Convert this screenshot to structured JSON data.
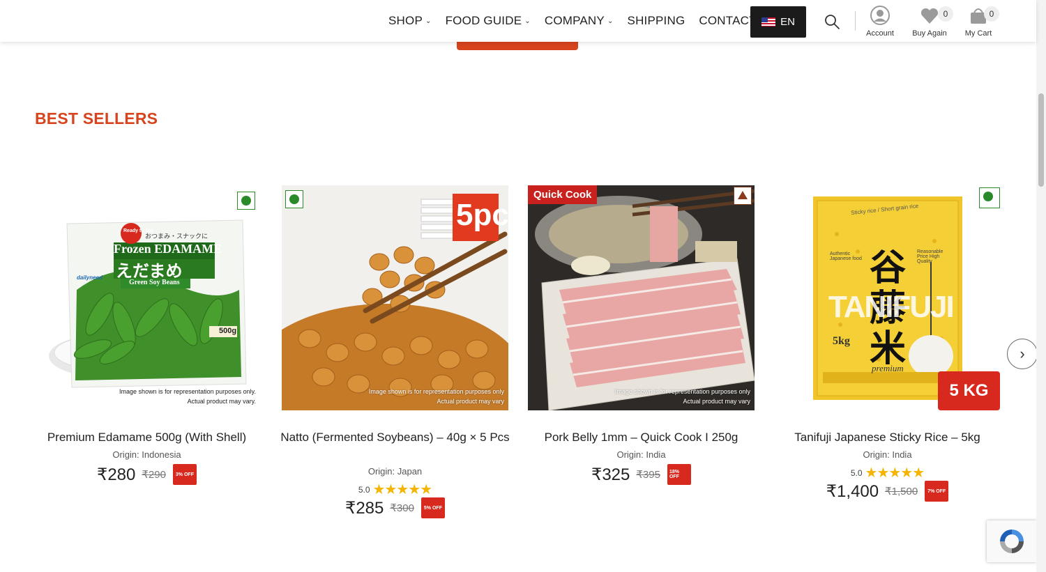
{
  "nav": {
    "items": [
      {
        "label": "SHOP",
        "dropdown": true
      },
      {
        "label": "FOOD GUIDE",
        "dropdown": true
      },
      {
        "label": "COMPANY",
        "dropdown": true
      },
      {
        "label": "SHIPPING",
        "dropdown": false
      },
      {
        "label": "CONTACT",
        "dropdown": false
      }
    ],
    "language": "EN",
    "account_label": "Account",
    "buy_again_label": "Buy Again",
    "buy_again_count": "0",
    "cart_label": "My Cart",
    "cart_count": "0"
  },
  "section": {
    "title": "BEST SELLERS"
  },
  "products": [
    {
      "name": "Premium Edamame 500g (With Shell)",
      "origin": "Origin: Indonesia",
      "price": "₹280",
      "mrp": "₹290",
      "discount": "3% OFF",
      "diet": "veg",
      "image_disclaimer": [
        "Image shown is for representation purposes only.",
        "Actual product may vary."
      ],
      "packaging": {
        "badge_top": "Ready to Eat",
        "brand": "dailyneed",
        "title": "Frozen EDAMAME",
        "jp": "えだまめ",
        "sub": "Green Soy Beans",
        "jp_small": "おつまみ・スナックに",
        "weight": "500g"
      }
    },
    {
      "name": "Natto (Fermented Soybeans) – 40g × 5 Pcs",
      "origin": "Origin: Japan",
      "rating": "5.0",
      "rating_value": 5,
      "price": "₹285",
      "mrp": "₹300",
      "discount": "5% OFF",
      "diet": "veg",
      "image_tag": "5pc",
      "image_disclaimer": [
        "Image shown is for representation purposes only",
        "Actual product may vary"
      ]
    },
    {
      "name": "Pork Belly 1mm – Quick Cook I 250g",
      "origin": "Origin: India",
      "price": "₹325",
      "mrp": "₹395",
      "discount": "18% OFF",
      "diet": "non-veg",
      "image_tag": "Quick Cook",
      "image_disclaimer": [
        "Image shown is for representation purposes only",
        "Actual product may vary"
      ]
    },
    {
      "name": "Tanifuji Japanese Sticky Rice – 5kg",
      "origin": "Origin: India",
      "rating": "5.0",
      "rating_value": 5,
      "price": "₹1,400",
      "mrp": "₹1,500",
      "discount": "7% OFF",
      "diet": "veg",
      "image_tag": "5 KG",
      "packaging": {
        "kanji": "谷藤米",
        "latin": "TANIFUJI",
        "weight": "5kg",
        "script": "premium",
        "top": "Sticky rice / Short grain rice",
        "left_note": "Authentic Japanese food",
        "right_note": "Reasonable Price High Quality"
      }
    }
  ],
  "colors": {
    "accent": "#d8441e",
    "discount": "#d8291e",
    "veg": "#2a8a2a",
    "nonveg": "#8b3a1e",
    "star": "#f4b400"
  },
  "icons": [
    "search-icon",
    "account-icon",
    "heart-icon",
    "cart-icon",
    "chevron-right-icon",
    "recaptcha-icon"
  ]
}
